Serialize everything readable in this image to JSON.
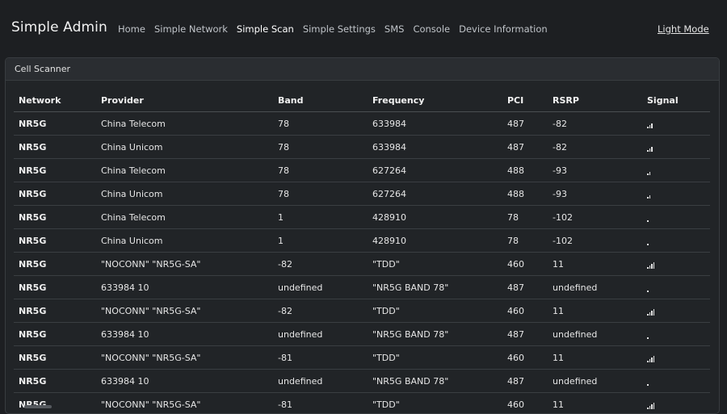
{
  "app": {
    "title": "Simple Admin",
    "light_mode_label": "Light Mode"
  },
  "nav": {
    "items": [
      {
        "label": "Home",
        "active": false
      },
      {
        "label": "Simple Network",
        "active": false
      },
      {
        "label": "Simple Scan",
        "active": true
      },
      {
        "label": "Simple Settings",
        "active": false
      },
      {
        "label": "SMS",
        "active": false
      },
      {
        "label": "Console",
        "active": false
      },
      {
        "label": "Device Information",
        "active": false
      }
    ]
  },
  "card": {
    "title": "Cell Scanner"
  },
  "table": {
    "headers": [
      "Network",
      "Provider",
      "Band",
      "Frequency",
      "PCI",
      "RSRP",
      "Signal"
    ],
    "rows": [
      {
        "network": "NR5G",
        "provider": "China Telecom",
        "band": "78",
        "frequency": "633984",
        "pci": "487",
        "rsrp": "-82",
        "signal_bars": 3
      },
      {
        "network": "NR5G",
        "provider": "China Unicom",
        "band": "78",
        "frequency": "633984",
        "pci": "487",
        "rsrp": "-82",
        "signal_bars": 3
      },
      {
        "network": "NR5G",
        "provider": "China Telecom",
        "band": "78",
        "frequency": "627264",
        "pci": "488",
        "rsrp": "-93",
        "signal_bars": 2
      },
      {
        "network": "NR5G",
        "provider": "China Unicom",
        "band": "78",
        "frequency": "627264",
        "pci": "488",
        "rsrp": "-93",
        "signal_bars": 2
      },
      {
        "network": "NR5G",
        "provider": "China Telecom",
        "band": "1",
        "frequency": "428910",
        "pci": "78",
        "rsrp": "-102",
        "signal_bars": 1
      },
      {
        "network": "NR5G",
        "provider": "China Unicom",
        "band": "1",
        "frequency": "428910",
        "pci": "78",
        "rsrp": "-102",
        "signal_bars": 1
      },
      {
        "network": "NR5G",
        "provider": "\"NOCONN\" \"NR5G-SA\"",
        "band": "-82",
        "frequency": "\"TDD\"",
        "pci": "460",
        "rsrp": "11",
        "signal_bars": 4
      },
      {
        "network": "NR5G",
        "provider": "633984 10",
        "band": "undefined",
        "frequency": "\"NR5G BAND 78\"",
        "pci": "487",
        "rsrp": "undefined",
        "signal_bars": 1
      },
      {
        "network": "NR5G",
        "provider": "\"NOCONN\" \"NR5G-SA\"",
        "band": "-82",
        "frequency": "\"TDD\"",
        "pci": "460",
        "rsrp": "11",
        "signal_bars": 4
      },
      {
        "network": "NR5G",
        "provider": "633984 10",
        "band": "undefined",
        "frequency": "\"NR5G BAND 78\"",
        "pci": "487",
        "rsrp": "undefined",
        "signal_bars": 1
      },
      {
        "network": "NR5G",
        "provider": "\"NOCONN\" \"NR5G-SA\"",
        "band": "-81",
        "frequency": "\"TDD\"",
        "pci": "460",
        "rsrp": "11",
        "signal_bars": 4
      },
      {
        "network": "NR5G",
        "provider": "633984 10",
        "band": "undefined",
        "frequency": "\"NR5G BAND 78\"",
        "pci": "487",
        "rsrp": "undefined",
        "signal_bars": 1
      },
      {
        "network": "NR5G",
        "provider": "\"NOCONN\" \"NR5G-SA\"",
        "band": "-81",
        "frequency": "\"TDD\"",
        "pci": "460",
        "rsrp": "11",
        "signal_bars": 4
      }
    ]
  }
}
